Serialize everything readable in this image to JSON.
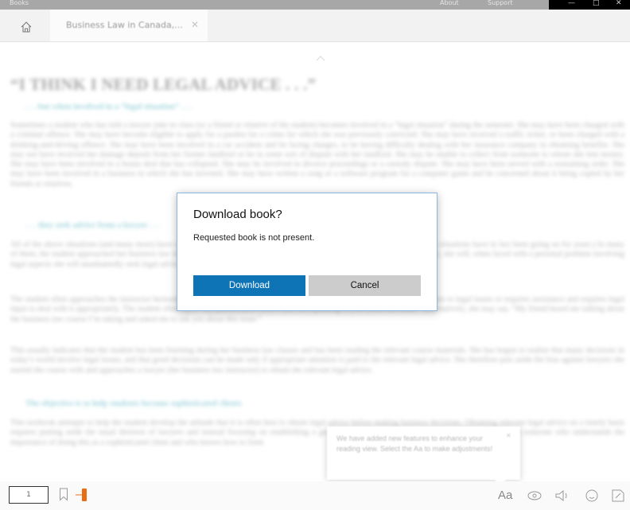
{
  "titlebar": {
    "left_text": "Books",
    "about": "About",
    "support": "Support",
    "minimize": "—",
    "maximize": "□",
    "close": "✕"
  },
  "tab": {
    "label": "Business Law in Canada,...",
    "close": "✕"
  },
  "reader": {
    "title": "“I THINK I NEED LEGAL ADVICE . . .”",
    "sub1": ". . . but when involved in a “legal situation” . . .",
    "p1": "Sometimes a student who has told a lawyer joke in class (or a friend or relative of the student) becomes involved in a “legal situation” during the semester. She may have been charged with a criminal offence. She may have become eligible to apply for a pardon for a crime for which she was previously convicted. She may have received a traffic ticket, or been charged with a drinking-and-driving offence. She may have been involved in a car accident and be facing charges, or be having difficulty dealing with her insurance company in obtaining benefits. She may not have received her damage deposit from her former landlord or be in some sort of dispute with her landlord. She may be unable to collect from someone to whom she lent money. She may have been involved in a house deal that has collapsed. She may be involved in divorce proceedings or a custody dispute. She may have been served with a restraining order. She may have been involved in a business in which she has invested. She may have written a song or a software program for a computer game and be concerned about it being copied by her friends or relatives.",
    "sub2": ". . . they seek advice from a lawyer . . .",
    "p2": "All of the above situations (and many more) have occurred to students using this textbook during recent semesters. (Some of these situations have in fact been going on for years.) In many of them, the student approached her business law instructor to ask for advice. That is, while the typical student may not like lawyers, she will, when faced with a personal problem involving legal aspects she will unashamedly seek legal advice from her business law instructor.",
    "p3": "The student often approaches the instructor hesitantly, by suggesting that she (the student (or her friend or relative) is involved relates to legal issues or requires assistance and requires legal input to deal with it appropriately. The student often says, “My parents don’t know that I am speaking to you about this issue.” Alternatively, she may say, “My friend heard me talking about the business law course I’m taking and asked me to ask you about this issue.”",
    "p4": "This usually indicates that the student has been listening during her business law classes and has been reading the relevant course materials. She has begun to realize that many decisions in today’s world involve legal issues, and that good decisions can be made only if appropriate attention is paid to the relevant legal advice. She therefore puts aside the bias against lawyers she started the course with and approaches a lawyer (her business law instructor) to obtain the relevant legal advice.",
    "sub3": "The objective is to help students become sophisticated clients",
    "p5": "This textbook attempts to help the student develop the attitude that it is often best to obtain legal advice before making business decisions. Obtaining relevant legal advice on a timely basis requires putting aside the usual derision of lawyers and instead focusing on establishing a good long-term relationship with a lawyer. We will refer to someone who understands the importance of doing this as a sophisticated client and who knows how to form"
  },
  "dialog": {
    "title": "Download book?",
    "message": "Requested book is not present.",
    "download_label": "Download",
    "cancel_label": "Cancel"
  },
  "toast": {
    "text": "We have added new features to enhance your reading view. Select the Aa to make adjustments!",
    "close": "✕"
  },
  "bottombar": {
    "page_value": "1",
    "text_options": "Aa"
  },
  "icons": [
    "home-icon",
    "chevron-up-icon",
    "bookmark-icon",
    "text-options-icon",
    "read-aloud-icon",
    "volume-icon",
    "emoji-icon",
    "notes-icon"
  ],
  "colors": {
    "accent_blue": "#0f74b5",
    "cancel_gray": "#cccccc",
    "progress_orange": "#e86e16",
    "dialog_border": "#8fb6dc"
  }
}
